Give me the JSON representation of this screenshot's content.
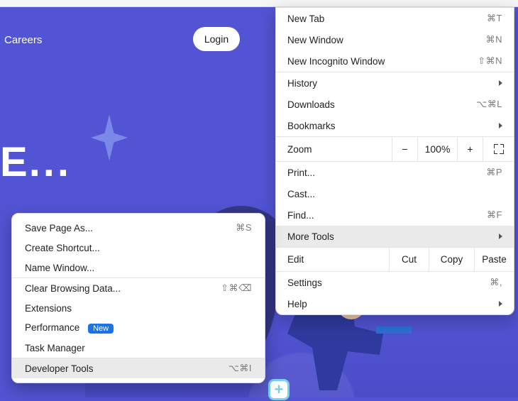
{
  "page": {
    "nav_careers": "Careers",
    "login_label": "Login",
    "hero_line": "E",
    "hero_dots": "..."
  },
  "menu": {
    "new_tab": "New Tab",
    "new_tab_sc": "⌘T",
    "new_window": "New Window",
    "new_window_sc": "⌘N",
    "incognito": "New Incognito Window",
    "incognito_sc": "⇧⌘N",
    "history": "History",
    "downloads": "Downloads",
    "downloads_sc": "⌥⌘L",
    "bookmarks": "Bookmarks",
    "zoom": "Zoom",
    "zoom_minus": "−",
    "zoom_value": "100%",
    "zoom_plus": "+",
    "print": "Print...",
    "print_sc": "⌘P",
    "cast": "Cast...",
    "find": "Find...",
    "find_sc": "⌘F",
    "more_tools": "More Tools",
    "edit": "Edit",
    "cut": "Cut",
    "copy": "Copy",
    "paste": "Paste",
    "settings": "Settings",
    "settings_sc": "⌘,",
    "help": "Help"
  },
  "submenu": {
    "save_page": "Save Page As...",
    "save_page_sc": "⌘S",
    "create_shortcut": "Create Shortcut...",
    "name_window": "Name Window...",
    "clear_data": "Clear Browsing Data...",
    "clear_data_sc": "⇧⌘⌫",
    "extensions": "Extensions",
    "performance": "Performance",
    "perf_badge": "New",
    "task_manager": "Task Manager",
    "dev_tools": "Developer Tools",
    "dev_tools_sc": "⌥⌘I"
  }
}
